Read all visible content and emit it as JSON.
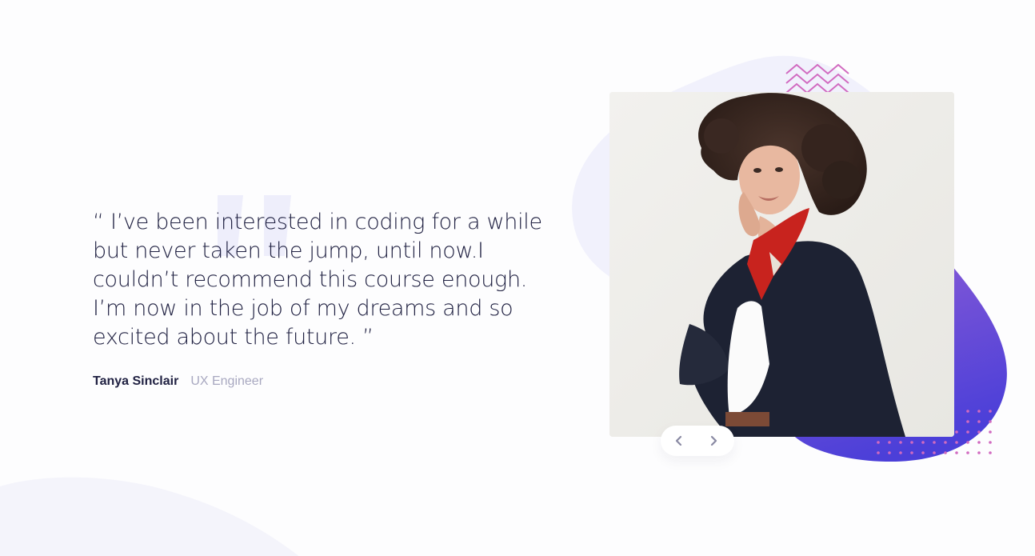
{
  "testimonial": {
    "quote": "“ I’ve been interested in coding for a while but never taken the jump, until now.I couldn’t recommend this course enough. I’m now in the job of my dreams and so excited about the future. ”",
    "author_name": "Tanya Sinclair",
    "author_role": "UX Engineer"
  },
  "photo": {
    "subject": "portrait-photo"
  },
  "navigation": {
    "prev_icon": "chevron-left-icon",
    "next_icon": "chevron-right-icon"
  },
  "colors": {
    "heading": "#202142",
    "muted": "#a8a8c0",
    "quote_mark": "#eeeefb",
    "light_blob": "#f1f1fc",
    "purple_start": "#8b5cd6",
    "purple_end": "#4b3fd8",
    "accent_pink": "#d16ac0",
    "background": "#fdfdfe"
  }
}
